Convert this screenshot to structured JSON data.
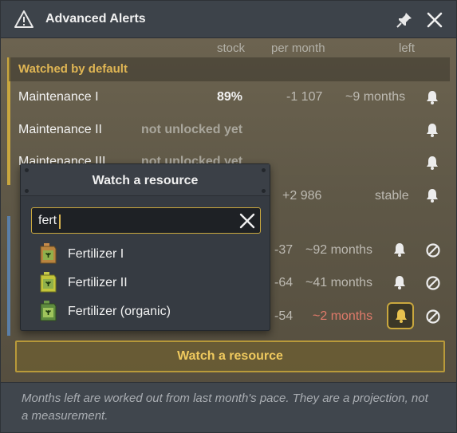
{
  "window": {
    "title": "Advanced Alerts",
    "icons": {
      "warning": "warning-triangle-icon",
      "pin": "pin-icon",
      "close": "close-icon"
    }
  },
  "columns": {
    "stock": "stock",
    "per_month": "per month",
    "left": "left"
  },
  "section": {
    "title": "Watched by default"
  },
  "rows": [
    {
      "label": "Maintenance I",
      "stock": "89%",
      "per_month": "-1 107",
      "left": "~9 months"
    },
    {
      "label": "Maintenance II",
      "status": "not unlocked yet"
    },
    {
      "label": "Maintenance III",
      "status": "not unlocked yet"
    },
    {
      "per_month": "+2 986",
      "left": "stable"
    },
    {
      "per_month": "-37",
      "left": "~92 months"
    },
    {
      "per_month": "-64",
      "left": "~41 months"
    },
    {
      "per_month": "-54",
      "left": "~2 months"
    }
  ],
  "watch_button": {
    "label": "Watch a resource"
  },
  "footer": {
    "note": "Months left are worked out from last month's pace. They are a projection, not a measurement."
  },
  "popup": {
    "title": "Watch a resource",
    "search": {
      "value": "fert",
      "placeholder": ""
    },
    "results": [
      {
        "label": "Fertilizer I",
        "icon": "fertilizer-canister-icon"
      },
      {
        "label": "Fertilizer II",
        "icon": "fertilizer-canister-icon"
      },
      {
        "label": "Fertilizer (organic)",
        "icon": "fertilizer-organic-canister-icon"
      }
    ]
  },
  "colors": {
    "accent": "#e0b654",
    "warning_text": "#e07a6a",
    "panel": "#3d434a"
  }
}
